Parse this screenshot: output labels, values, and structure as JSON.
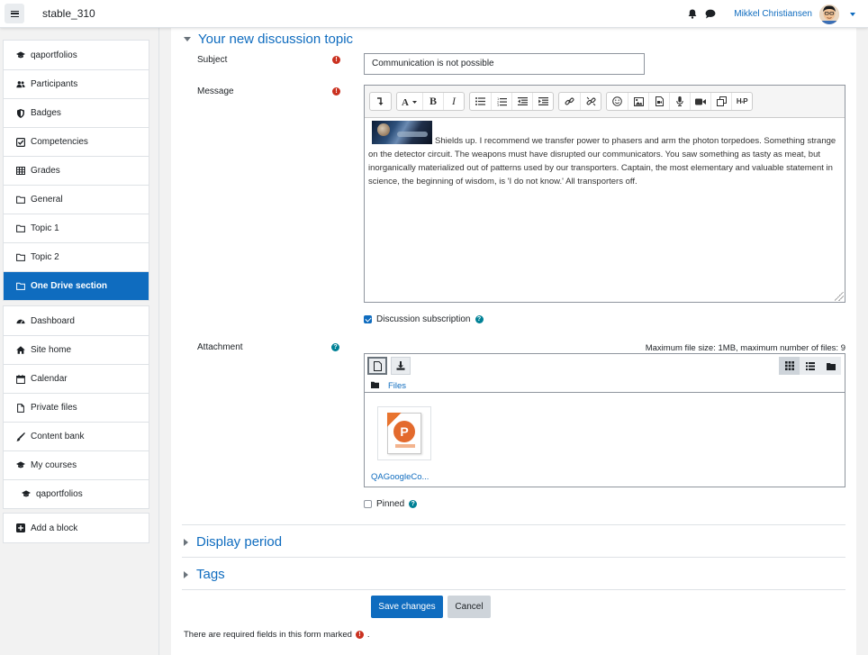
{
  "header": {
    "site_name": "stable_310",
    "user_name": "Mikkel Christiansen"
  },
  "sidebar": {
    "group1": [
      {
        "label": "qaportfolios",
        "icon": "graduation-cap-icon"
      },
      {
        "label": "Participants",
        "icon": "users-icon"
      },
      {
        "label": "Badges",
        "icon": "shield-icon"
      },
      {
        "label": "Competencies",
        "icon": "check-square-icon"
      },
      {
        "label": "Grades",
        "icon": "table-icon"
      },
      {
        "label": "General",
        "icon": "folder-icon"
      },
      {
        "label": "Topic 1",
        "icon": "folder-icon"
      },
      {
        "label": "Topic 2",
        "icon": "folder-icon"
      },
      {
        "label": "One Drive section",
        "icon": "folder-icon"
      }
    ],
    "group2": [
      {
        "label": "Dashboard",
        "icon": "dashboard-icon"
      },
      {
        "label": "Site home",
        "icon": "home-icon"
      },
      {
        "label": "Calendar",
        "icon": "calendar-icon"
      },
      {
        "label": "Private files",
        "icon": "file-icon"
      },
      {
        "label": "Content bank",
        "icon": "brush-icon"
      },
      {
        "label": "My courses",
        "icon": "graduation-cap-icon"
      },
      {
        "label": "qaportfolios",
        "icon": "graduation-cap-icon"
      }
    ],
    "add_block": "Add a block"
  },
  "form": {
    "section_title": "Your new discussion topic",
    "subject_label": "Subject",
    "subject_value": "Communication is not possible",
    "message_label": "Message",
    "message_text": "Shields up. I recommend we transfer power to phasers and arm the photon torpedoes. Something strange on the detector circuit. The weapons must have disrupted our communicators. You saw something as tasty as meat, but inorganically materialized out of patterns used by our transporters. Captain, the most elementary and valuable statement in science, the beginning of wisdom, is 'I do not know.' All transporters off.",
    "discussion_subscription": "Discussion subscription",
    "attachment_label": "Attachment",
    "max_size": "Maximum file size: 1MB, maximum number of files: 9",
    "files_path": "Files",
    "file_name": "QAGoogleCo...",
    "pinned": "Pinned",
    "display_period": "Display period",
    "tags": "Tags",
    "save": "Save changes",
    "cancel": "Cancel",
    "required_note": "There are required fields in this form marked",
    "required_note_end": "."
  },
  "editor_toolbar": {
    "bold": "B",
    "italic": "I",
    "h5p": "H-P"
  },
  "colors": {
    "primary": "#0f6cbf",
    "required": "#ca3120",
    "help": "#008196"
  }
}
